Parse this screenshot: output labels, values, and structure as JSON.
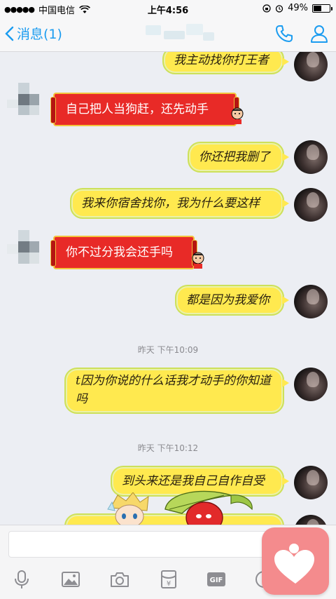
{
  "status_bar": {
    "carrier": "中国电信",
    "time": "上午4:56",
    "battery_percent": "49%",
    "battery_level": 0.49
  },
  "nav": {
    "back_label": "消息(1)"
  },
  "messages": [
    {
      "side": "right",
      "style": "yellow",
      "text": "我主动找你打王者"
    },
    {
      "side": "left",
      "style": "red",
      "text": "自己把人当狗赶，还先动手"
    },
    {
      "side": "right",
      "style": "yellow",
      "text": "你还把我删了"
    },
    {
      "side": "right",
      "style": "yellow",
      "text": "我来你宿舍找你，我为什么要这样"
    },
    {
      "side": "left",
      "style": "red",
      "text": "你不过分我会还手吗"
    },
    {
      "side": "right",
      "style": "yellow",
      "text": "都是因为我爱你"
    },
    {
      "side": "right",
      "style": "yellow",
      "text": "t因为你说的什么话我才动手的你知道吗"
    },
    {
      "side": "right",
      "style": "yellow",
      "text": "到头来还是我自己自作自受"
    }
  ],
  "timestamps": [
    "昨天 下午10:09",
    "昨天 下午10:12"
  ],
  "toolbar": {
    "gif_label": "GIF",
    "hongbao_label": "¥"
  },
  "colors": {
    "accent": "#1b9cf0",
    "yellow_bubble": "#ffe94f",
    "red_bubble": "#e82a27",
    "overlay_pink": "#f48b8d"
  }
}
